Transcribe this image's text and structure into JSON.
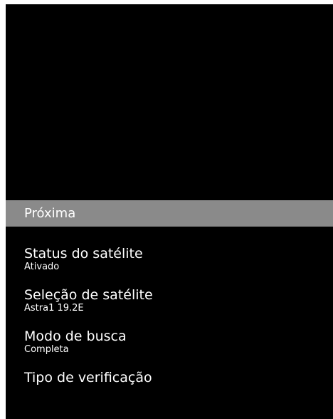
{
  "menu": {
    "items": [
      {
        "label": "Próxima"
      },
      {
        "label": "Status do satélite",
        "value": "Ativado"
      },
      {
        "label": "Seleção de satélite",
        "value": "Astra1 19.2E"
      },
      {
        "label": "Modo de busca",
        "value": "Completa"
      },
      {
        "label": "Tipo de verificação"
      }
    ]
  },
  "colors": {
    "background": "#000000",
    "selected_bar": "#8a8a8a",
    "text": "#ffffff"
  }
}
